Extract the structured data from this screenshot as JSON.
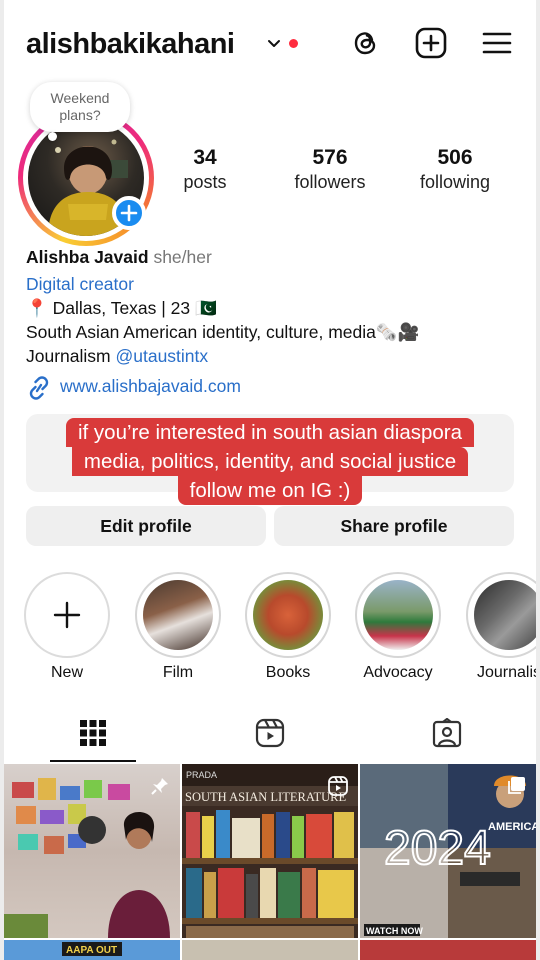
{
  "header": {
    "username": "alishbakikahani",
    "icons": [
      "chevron-down-icon",
      "notification-dot",
      "threads-icon",
      "create-post-icon",
      "menu-icon"
    ]
  },
  "profile": {
    "note": "Weekend plans?",
    "stats": [
      {
        "value": "34",
        "label": "posts"
      },
      {
        "value": "576",
        "label": "followers"
      },
      {
        "value": "506",
        "label": "following"
      }
    ]
  },
  "bio": {
    "name": "Alishba Javaid",
    "pronouns": "she/her",
    "category": "Digital creator",
    "location": "📍 Dallas, Texas | 23 🇵🇰",
    "line1": "South Asian American identity, culture, media🗞️🎥",
    "journalism_prefix": "Journalism ",
    "mention": "@utaustintx",
    "link": "www.alishbajavaid.com"
  },
  "caption": {
    "line1": "if you’re interested in south asian diaspora",
    "line2": "media, politics, identity, and social justice",
    "line3": "follow me on IG :)"
  },
  "buttons": {
    "edit": "Edit profile",
    "share": "Share profile"
  },
  "highlights": [
    {
      "label": "New"
    },
    {
      "label": "Film"
    },
    {
      "label": "Books"
    },
    {
      "label": "Advocacy"
    },
    {
      "label": "Journalis"
    }
  ],
  "tabs": [
    "posts-grid-icon",
    "reels-icon",
    "tagged-icon"
  ],
  "grid": {
    "tile2_text": "SOUTH ASIAN LITERATURE",
    "tile2_top": "PRADA",
    "tile3_year": "2024",
    "tile3_watch": "WATCH NOW",
    "tile3_side": "AMERICAN SIKH",
    "tile4_text": "AAPA OUT"
  }
}
